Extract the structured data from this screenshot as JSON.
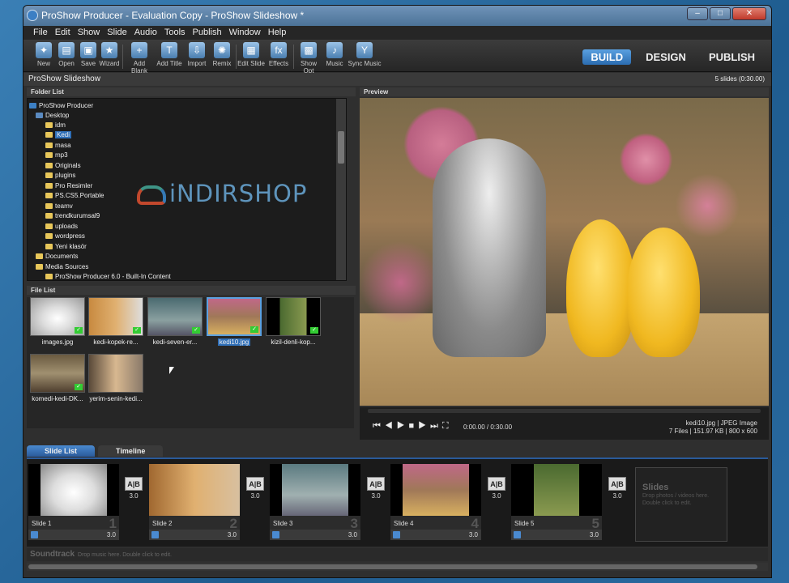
{
  "window": {
    "title": "ProShow Producer - Evaluation Copy - ProShow Slideshow *"
  },
  "menu": [
    "File",
    "Edit",
    "Show",
    "Slide",
    "Audio",
    "Tools",
    "Publish",
    "Window",
    "Help"
  ],
  "toolbar": [
    {
      "label": "New",
      "icon": "new-icon"
    },
    {
      "label": "Open",
      "icon": "open-icon"
    },
    {
      "label": "Save",
      "icon": "save-icon"
    },
    {
      "label": "Wizard",
      "icon": "wizard-icon"
    },
    {
      "label": "Add Blank",
      "icon": "add-blank-icon"
    },
    {
      "label": "Add Title",
      "icon": "add-title-icon"
    },
    {
      "label": "Import",
      "icon": "import-icon"
    },
    {
      "label": "Remix",
      "icon": "remix-icon"
    },
    {
      "label": "Edit Slide",
      "icon": "edit-slide-icon"
    },
    {
      "label": "Effects",
      "icon": "effects-icon"
    },
    {
      "label": "Show Opt",
      "icon": "show-options-icon"
    },
    {
      "label": "Music",
      "icon": "music-icon"
    },
    {
      "label": "Sync Music",
      "icon": "sync-music-icon"
    }
  ],
  "modes": {
    "build": "BUILD",
    "design": "DESIGN",
    "publish": "PUBLISH"
  },
  "slideshow": {
    "name": "ProShow Slideshow",
    "count": "5 slides (0:30.00)"
  },
  "folder_list": {
    "header": "Folder List",
    "items": [
      "ProShow Producer",
      "Desktop",
      "idm",
      "Kedi",
      "masa",
      "mp3",
      "Originals",
      "plugins",
      "Pro Resimler",
      "PS.CS5.Portable",
      "teamv",
      "trendkurumsal9",
      "uploads",
      "wordpress",
      "Yeni klasör",
      "Documents",
      "Media Sources",
      "ProShow Producer 6.0 - Built-In Content"
    ]
  },
  "watermark": {
    "text": "iNDIRSHOP"
  },
  "file_list": {
    "header": "File List",
    "items": [
      "images.jpg",
      "kedi-kopek-re...",
      "kedi-seven-er...",
      "kedi10.jpg",
      "kizil-denli-kop...",
      "komedi-kedi-DK...",
      "yerim-senin-kedi..."
    ]
  },
  "preview": {
    "header": "Preview",
    "time": "0:00.00 / 0:30.00",
    "file": "kedi10.jpg | JPEG Image",
    "info": "7 Files | 151.97 KB | 800 x 600"
  },
  "tabs": {
    "slide_list": "Slide List",
    "timeline": "Timeline"
  },
  "slides": [
    {
      "label": "Slide 1",
      "num": "1",
      "dur": "3.0",
      "trans": "3.0"
    },
    {
      "label": "Slide 2",
      "num": "2",
      "dur": "3.0",
      "trans": "3.0"
    },
    {
      "label": "Slide 3",
      "num": "3",
      "dur": "3.0",
      "trans": "3.0"
    },
    {
      "label": "Slide 4",
      "num": "4",
      "dur": "3.0",
      "trans": "3.0"
    },
    {
      "label": "Slide 5",
      "num": "5",
      "dur": "3.0",
      "trans": "3.0"
    }
  ],
  "empty_slot": {
    "title": "Slides",
    "hint1": "Drop photos / videos here.",
    "hint2": "Double click to edit."
  },
  "soundtrack": {
    "label": "Soundtrack",
    "hint": "Drop music here.  Double click to edit."
  }
}
